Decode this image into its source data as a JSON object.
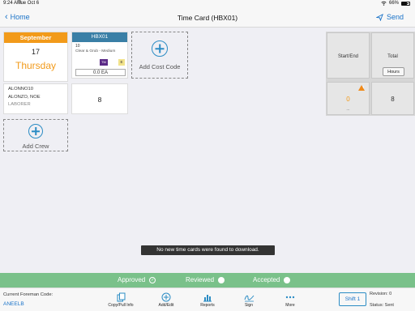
{
  "status_bar": {
    "time": "9:24 AM",
    "date": "Tue Oct 6",
    "battery": "66%",
    "battery_level": 0.66
  },
  "nav": {
    "back_label": "Home",
    "title": "Time Card (HBX01)",
    "send_label": "Send"
  },
  "date_card": {
    "month": "September",
    "day": "17",
    "weekday": "Thursday"
  },
  "cost_code": {
    "header": "HBX01",
    "number": "10",
    "description": "Clear & Grub - Medium",
    "tm_badge": "TM",
    "e_badge": "E",
    "quantity": "0.0 EA"
  },
  "add_cost_code": {
    "label": "Add Cost Code"
  },
  "employee": {
    "id": "ALONNO10",
    "name": "ALONZO, NOE",
    "role": "LABORER",
    "hours": "8"
  },
  "add_crew": {
    "label": "Add Crew"
  },
  "right_panel": {
    "start_end_header": "Start/End",
    "total_header": "Total",
    "hours_button": "Hours",
    "start_end_value": "0",
    "start_end_sub": "...",
    "total_value": "8",
    "warning_symbol": "!"
  },
  "toast": {
    "message": "No new time cards were found to download."
  },
  "approval": {
    "approved": "Approved",
    "reviewed": "Reviewed",
    "accepted": "Accepted"
  },
  "bottom": {
    "foreman_label": "Current Foreman Code:",
    "foreman_code": "ANEELB",
    "toolbar": [
      {
        "label": "Copy/Pull Info",
        "icon": "copy-icon"
      },
      {
        "label": "Add/Edit",
        "icon": "add-circle-icon"
      },
      {
        "label": "Reports",
        "icon": "bar-chart-icon"
      },
      {
        "label": "Sign",
        "icon": "signature-icon"
      },
      {
        "label": "More",
        "icon": "ellipsis-icon"
      }
    ],
    "shift_button": "Shift 1",
    "revision": "Revision: 0",
    "status": "Status: Sent"
  },
  "colors": {
    "accent_orange": "#f29a1a",
    "header_teal": "#3a7fa6",
    "approval_green": "#7ac18a",
    "link_blue": "#1a73c8"
  }
}
